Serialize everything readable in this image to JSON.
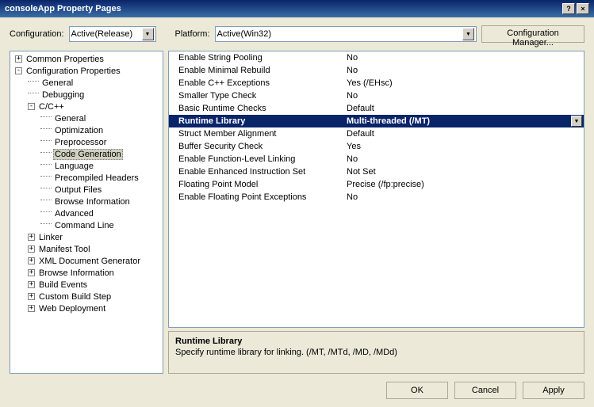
{
  "title": "consoleApp Property Pages",
  "topbar": {
    "config_label": "Configuration:",
    "config_value": "Active(Release)",
    "platform_label": "Platform:",
    "platform_value": "Active(Win32)",
    "config_manager": "Configuration Manager..."
  },
  "tree": [
    {
      "indent": 0,
      "toggle": "+",
      "label": "Common Properties"
    },
    {
      "indent": 0,
      "toggle": "-",
      "label": "Configuration Properties"
    },
    {
      "indent": 1,
      "toggle": "",
      "label": "General"
    },
    {
      "indent": 1,
      "toggle": "",
      "label": "Debugging"
    },
    {
      "indent": 1,
      "toggle": "-",
      "label": "C/C++"
    },
    {
      "indent": 2,
      "toggle": "",
      "label": "General"
    },
    {
      "indent": 2,
      "toggle": "",
      "label": "Optimization"
    },
    {
      "indent": 2,
      "toggle": "",
      "label": "Preprocessor"
    },
    {
      "indent": 2,
      "toggle": "",
      "label": "Code Generation",
      "selected": true
    },
    {
      "indent": 2,
      "toggle": "",
      "label": "Language"
    },
    {
      "indent": 2,
      "toggle": "",
      "label": "Precompiled Headers"
    },
    {
      "indent": 2,
      "toggle": "",
      "label": "Output Files"
    },
    {
      "indent": 2,
      "toggle": "",
      "label": "Browse Information"
    },
    {
      "indent": 2,
      "toggle": "",
      "label": "Advanced"
    },
    {
      "indent": 2,
      "toggle": "",
      "label": "Command Line"
    },
    {
      "indent": 1,
      "toggle": "+",
      "label": "Linker"
    },
    {
      "indent": 1,
      "toggle": "+",
      "label": "Manifest Tool"
    },
    {
      "indent": 1,
      "toggle": "+",
      "label": "XML Document Generator"
    },
    {
      "indent": 1,
      "toggle": "+",
      "label": "Browse Information"
    },
    {
      "indent": 1,
      "toggle": "+",
      "label": "Build Events"
    },
    {
      "indent": 1,
      "toggle": "+",
      "label": "Custom Build Step"
    },
    {
      "indent": 1,
      "toggle": "+",
      "label": "Web Deployment"
    }
  ],
  "grid": [
    {
      "name": "Enable String Pooling",
      "value": "No"
    },
    {
      "name": "Enable Minimal Rebuild",
      "value": "No"
    },
    {
      "name": "Enable C++ Exceptions",
      "value": "Yes (/EHsc)"
    },
    {
      "name": "Smaller Type Check",
      "value": "No"
    },
    {
      "name": "Basic Runtime Checks",
      "value": "Default"
    },
    {
      "name": "Runtime Library",
      "value": "Multi-threaded (/MT)",
      "selected": true
    },
    {
      "name": "Struct Member Alignment",
      "value": "Default"
    },
    {
      "name": "Buffer Security Check",
      "value": "Yes"
    },
    {
      "name": "Enable Function-Level Linking",
      "value": "No"
    },
    {
      "name": "Enable Enhanced Instruction Set",
      "value": "Not Set"
    },
    {
      "name": "Floating Point Model",
      "value": "Precise (/fp:precise)"
    },
    {
      "name": "Enable Floating Point Exceptions",
      "value": "No"
    }
  ],
  "desc": {
    "title": "Runtime Library",
    "text": "Specify runtime library for linking.     (/MT, /MTd, /MD, /MDd)"
  },
  "buttons": {
    "ok": "OK",
    "cancel": "Cancel",
    "apply": "Apply"
  }
}
